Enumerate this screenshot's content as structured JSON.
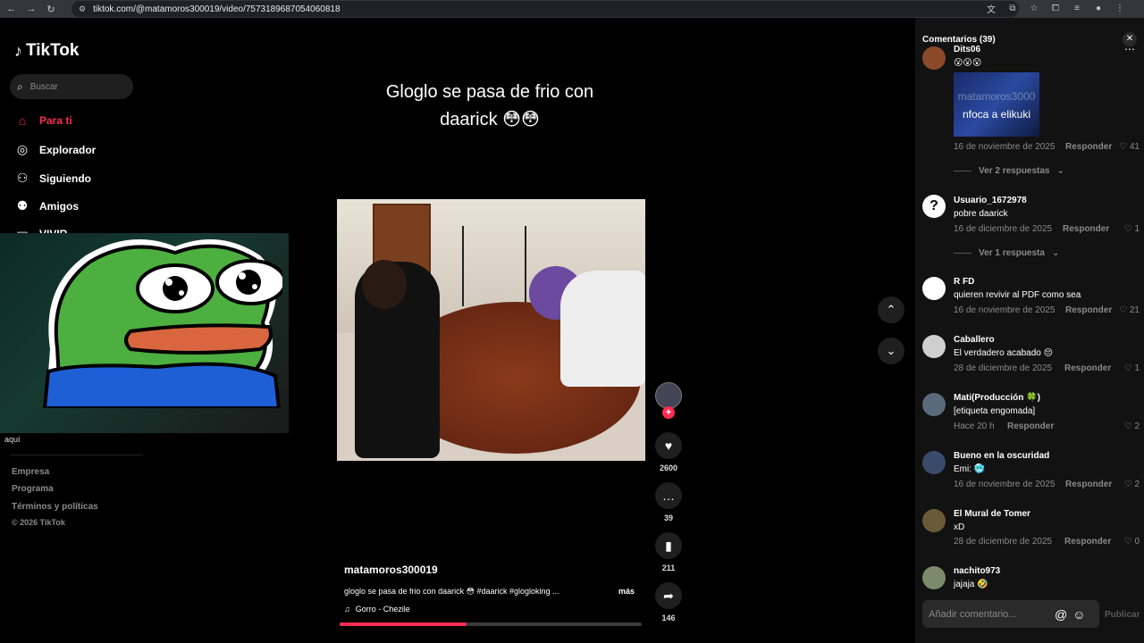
{
  "browser": {
    "url": "tiktok.com/@matamoros300019/video/7573189687054060818"
  },
  "sidebar": {
    "logo": "TikTok",
    "search_placeholder": "Buscar",
    "items": [
      {
        "label": "Para ti",
        "icon": "home-icon",
        "active": true
      },
      {
        "label": "Explorador",
        "icon": "compass-icon",
        "active": false
      },
      {
        "label": "Siguiendo",
        "icon": "following-icon",
        "active": false
      },
      {
        "label": "Amigos",
        "icon": "friends-icon",
        "active": false
      },
      {
        "label": "VIVIR",
        "icon": "live-icon",
        "active": false
      }
    ],
    "overlay_text": "aquí",
    "footer": [
      "Empresa",
      "Programa",
      "Términos y políticas",
      "© 2026 TikTok"
    ]
  },
  "video": {
    "title_line1": "Gloglo se pasa de frio con",
    "title_line2": "daarick 😳😳",
    "username": "matamoros300019",
    "description": "gloglo se pasa de frio con daarick 😳 #daarick #glogloking ...",
    "more": "más",
    "music": "Gorro - Chezile",
    "progress": 0.42
  },
  "actions": {
    "likes": "2600",
    "comments": "39",
    "saves": "211",
    "shares": "146"
  },
  "comments": {
    "title": "Comentarios (39)",
    "input_placeholder": "Añadir comentario...",
    "publish": "Publicar",
    "reply_label": "Responder",
    "list": [
      {
        "name": "Dits06",
        "text": "😮😮😮",
        "gif_text1": "matamoros3000",
        "gif_text2": "nfoca a elikuki",
        "date": "16 de noviembre de 2025",
        "likes": "41",
        "replies": "Ver 2 respuestas"
      },
      {
        "name": "Usuario_1672978",
        "text": "pobre daarick",
        "date": "16 de diciembre de 2025",
        "likes": "1",
        "replies": "Ver 1 respuesta"
      },
      {
        "name": "R FD",
        "text": "quieren revivir al PDF como sea",
        "date": "16 de noviembre de 2025",
        "likes": "21"
      },
      {
        "name": "Caballero",
        "text": "El verdadero acabado 😔",
        "date": "28 de diciembre de 2025",
        "likes": "1"
      },
      {
        "name": "Mati(Producción 🍀)",
        "text": "[etiqueta engomada]",
        "date": "Hace 20 h",
        "likes": "2"
      },
      {
        "name": "Bueno en la oscuridad",
        "text": "Emi: 🥶",
        "date": "16 de noviembre de 2025",
        "likes": "2"
      },
      {
        "name": "El Mural de Tomer",
        "text": "xD",
        "date": "28 de diciembre de 2025",
        "likes": "0"
      },
      {
        "name": "nachito973",
        "text": "jajaja 🤣"
      }
    ]
  }
}
